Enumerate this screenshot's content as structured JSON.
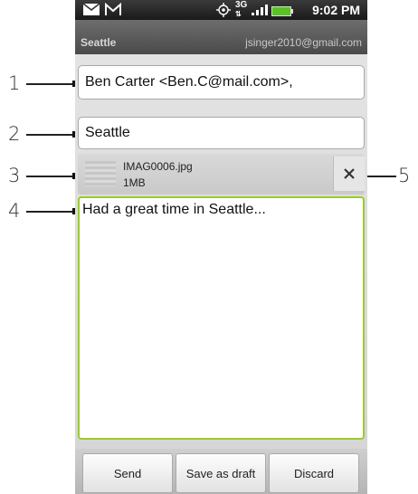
{
  "status_bar": {
    "time": "9:02 PM",
    "network": "3G",
    "icons": [
      "message-icon",
      "gmail-icon",
      "gps-icon",
      "3g-icon",
      "signal-icon",
      "battery-icon"
    ]
  },
  "title_bar": {
    "subject": "Seattle",
    "account": "jsinger2010@gmail.com"
  },
  "compose": {
    "to_value": "Ben Carter <Ben.C@mail.com>,",
    "subject_value": "Seattle",
    "attachment": {
      "name": "IMAG0006.jpg",
      "size": "1MB"
    },
    "message": "Had a great time in Seattle..."
  },
  "buttons": {
    "send": "Send",
    "save_draft": "Save as draft",
    "discard": "Discard"
  },
  "callouts": [
    "1",
    "2",
    "3",
    "4",
    "5"
  ],
  "colors": {
    "focus_border": "#9bcc2a",
    "battery": "#58c322"
  }
}
